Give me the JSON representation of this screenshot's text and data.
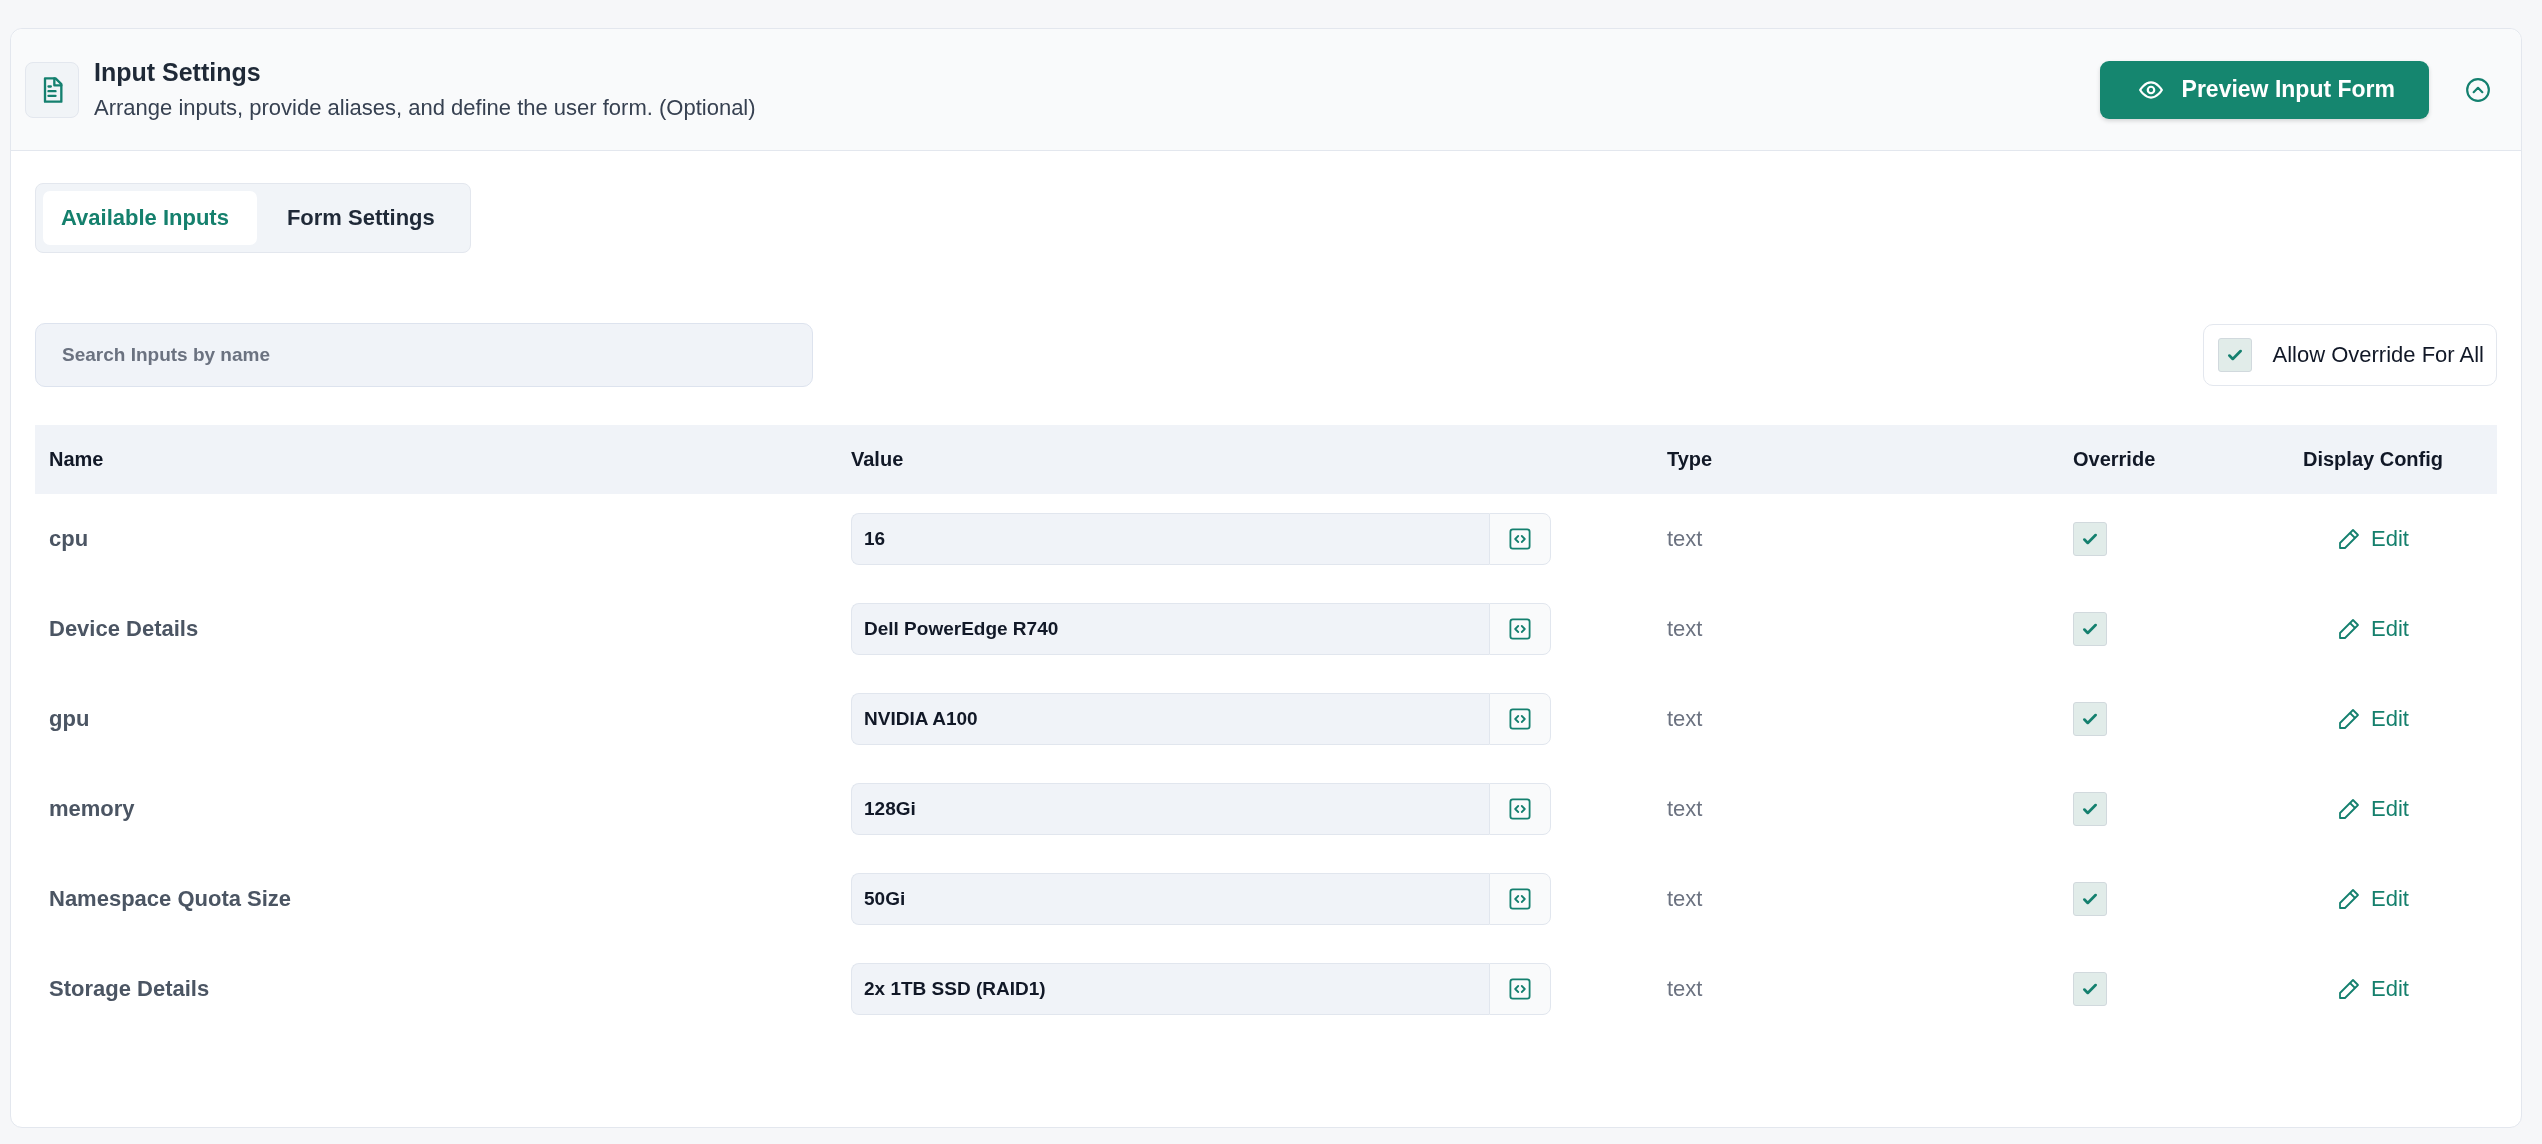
{
  "header": {
    "title": "Input Settings",
    "subtitle": "Arrange inputs, provide aliases, and define the user form. (Optional)",
    "preview_button": "Preview Input Form",
    "expanded": true
  },
  "tabs": [
    {
      "label": "Available Inputs",
      "selected": true
    },
    {
      "label": "Form Settings",
      "selected": false
    }
  ],
  "search": {
    "placeholder": "Search Inputs by name"
  },
  "allow_override_all": {
    "label": "Allow Override For All",
    "checked": true
  },
  "table": {
    "columns": [
      "Name",
      "Value",
      "Type",
      "Override",
      "Display Config"
    ],
    "rows": [
      {
        "name": "cpu",
        "value": "16",
        "type": "text",
        "override": true,
        "action": "Edit"
      },
      {
        "name": "Device Details",
        "value": "Dell PowerEdge R740",
        "type": "text",
        "override": true,
        "action": "Edit"
      },
      {
        "name": "gpu",
        "value": "NVIDIA A100",
        "type": "text",
        "override": true,
        "action": "Edit"
      },
      {
        "name": "memory",
        "value": "128Gi",
        "type": "text",
        "override": true,
        "action": "Edit"
      },
      {
        "name": "Namespace Quota Size",
        "value": "50Gi",
        "type": "text",
        "override": true,
        "action": "Edit"
      },
      {
        "name": "Storage Details",
        "value": "2x 1TB SSD (RAID1)",
        "type": "text",
        "override": true,
        "action": "Edit"
      }
    ]
  }
}
